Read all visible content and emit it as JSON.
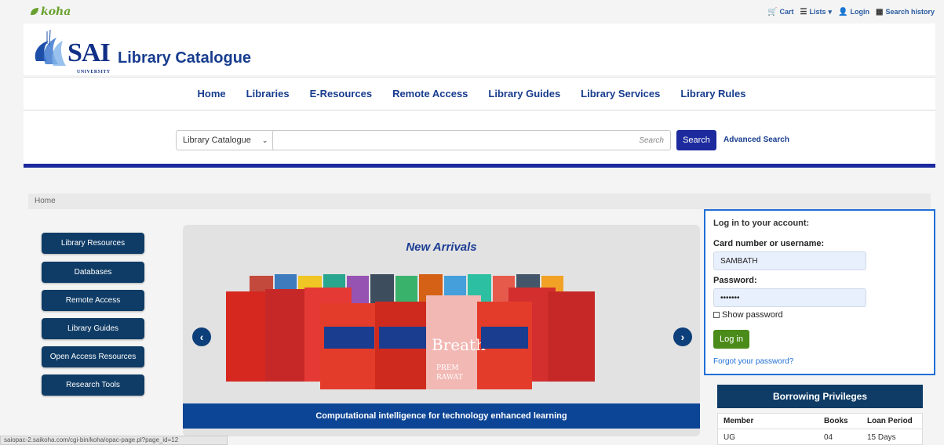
{
  "topbar": {
    "logo_text": "koha",
    "links": {
      "cart": "Cart",
      "lists": "Lists",
      "login": "Login",
      "search_history": "Search history"
    }
  },
  "header": {
    "logo_main": "SAI",
    "logo_sub": "UNIVERSITY",
    "title": "Library Catalogue"
  },
  "nav": {
    "items": [
      "Home",
      "Libraries",
      "E-Resources",
      "Remote Access",
      "Library Guides",
      "Library Services",
      "Library Rules"
    ]
  },
  "search": {
    "select_value": "Library Catalogue",
    "placeholder": "Search",
    "button": "Search",
    "advanced": "Advanced Search"
  },
  "breadcrumb": "Home",
  "left_menu": [
    "Library Resources",
    "Databases",
    "Remote Access",
    "Library Guides",
    "Open Access Resources",
    "Research Tools"
  ],
  "carousel": {
    "title": "New Arrivals",
    "caption": "Computational intelligence for technology enhanced learning",
    "prev": "‹",
    "next": "›"
  },
  "login": {
    "title": "Log in to your account:",
    "username_label": "Card number or username:",
    "username_value": "SAMBATH",
    "password_label": "Password:",
    "password_value": "•••••••",
    "show_password": "Show password",
    "button": "Log in",
    "forgot": "Forgot your password?"
  },
  "borrowing": {
    "title": "Borrowing Privileges",
    "columns": [
      "Member",
      "Books",
      "Loan Period"
    ],
    "rows": [
      [
        "UG",
        "04",
        "15 Days"
      ]
    ]
  },
  "status_url": "saiopac-2.saikoha.com/cgi-bin/koha/opac-page.pl?page_id=12",
  "colors": {
    "brand_blue": "#1c2a9e",
    "nav_text": "#173c8e",
    "button_dark": "#0f3c66",
    "login_green": "#4a8b1a",
    "login_border": "#1f6fd6"
  }
}
